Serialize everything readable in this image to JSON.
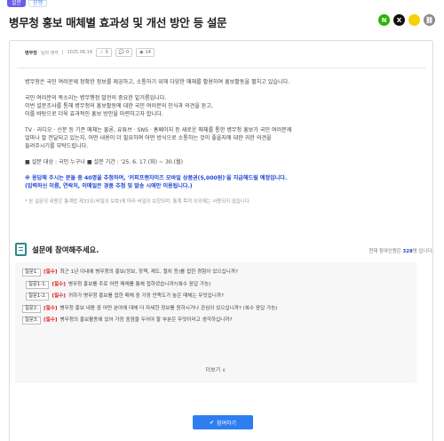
{
  "header": {
    "badge_primary": "설문",
    "badge_secondary": "진행",
    "title": "병무청 홍보 매체별 효과성 및 개선 방안 등 설문"
  },
  "share": [
    {
      "icon": "naver-icon",
      "glyph": "N",
      "color": "#2db400"
    },
    {
      "icon": "x-icon",
      "glyph": "X",
      "color": "#111111"
    },
    {
      "icon": "kakaotalk-icon",
      "glyph": "",
      "color": "#f7d000"
    },
    {
      "icon": "link-icon",
      "glyph": "⛓",
      "color": "#8a8a8a"
    }
  ],
  "meta": {
    "author": "병무청",
    "author_suffix": "님의 생각",
    "date": "2025.06.16",
    "likes": "0",
    "comments": "0",
    "views": "14"
  },
  "intro": {
    "p1": "병무청은 국민 여러분께 정확한 정보를 제공하고, 소통하기 위해 다양한 매체를 활용하여 홍보활동을 펼치고 있습니다.",
    "p2a": "국민 여러분의 목소리는 병무행정 발전의 중요한 밑거름입니다.",
    "p2b": "이번 설문조사를 통해 병무청의 홍보활동에 대한 국민 여러분의 인식과 의견을 듣고,",
    "p2c": "이를 바탕으로 더욱 효과적인 홍보 방안을 마련하고자 합니다.",
    "p3a": "TV · 라디오 · 신문 등 기존 매체는 물론, 유튜브 · SNS · 홈페이지 등 새로운 매체를 통한 병무청 홍보가 국민 여러분께",
    "p3b": "얼마나 잘 전달되고 있는지, 어떤 내용이 더 필요하며 어떤 방식으로 소통하는 것이 좋을지에 대한 귀한 의견을",
    "p3c": "들려주시기를 부탁드립니다.",
    "target": "■ 설문 대상 : 국민 누구나 ■ 설문 기간 : '25. 6. 17.(화) ~ 30.(월)",
    "prize1": "※ 응답해 주시는 분들 중 40명을 추첨하여, '커피프랜차이즈 모바일 상품권(5,000원)'을 지급해드릴 예정입니다.",
    "prize2": "(입력하신 이름, 연락처, 이메일은 경품 추첨 및 발송 시에만 이용됩니다.)",
    "note": "* 본 설문의 내용은 통계법 제33조(비밀의 보호)에 따라 비밀이 보장되며, 통계 목적 이외에는 사용되지 않습니다."
  },
  "survey": {
    "title": "설문에 참여해주세요.",
    "count_prefix": "현재 참여인원은",
    "count_value": "328",
    "count_suffix": "명 입니다.",
    "questions": [
      {
        "num": "질문1.",
        "req": "[필수]",
        "text": "최근 1년 이내에 병무청의 홍보(정보, 정책, 제도, 절차 등)를 접한 경험이 있으십니까?"
      },
      {
        "num": "질문1-1.",
        "req": "[필수]",
        "text": "병무청 홍보를 주로 어떤 매체를 통해 접하셨습니까?(복수 응답 가능)"
      },
      {
        "num": "질문1-2.",
        "req": "[필수]",
        "text": "귀하가 병무청 홍보를 접한 매체 중 가장 만족도가 높은 매체는 무엇입니까?"
      },
      {
        "num": "질문2.",
        "req": "[필수]",
        "text": "병무청 홍보 내용 중 어떤 분야에 대해 더 자세한 정보를 원하시거나 관심이 있으십니까? (복수 응답 가능)"
      },
      {
        "num": "질문3.",
        "req": "[필수]",
        "text": "병무청의 홍보활동에 있어 가장 중점을 두어야 할 부분은 무엇이라고 생각하십니까?"
      }
    ],
    "more_label": "더보기",
    "participate_label": "참여하기"
  }
}
